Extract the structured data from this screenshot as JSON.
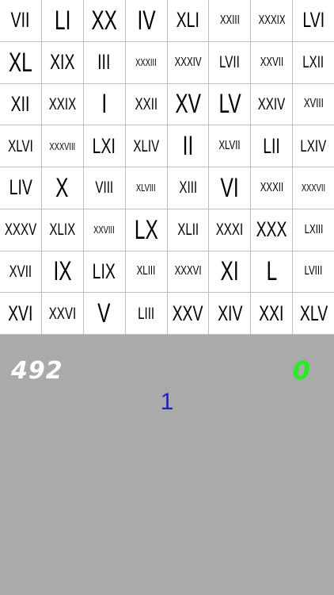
{
  "board": {
    "columns": 8,
    "rows": 8,
    "cells": [
      "VII",
      "LI",
      "XX",
      "IV",
      "XLI",
      "XXIII",
      "XXXIX",
      "LVI",
      "XL",
      "XIX",
      "III",
      "XXXIII",
      "XXXIV",
      "LVII",
      "XXVII",
      "LXII",
      "XII",
      "XXIX",
      "I",
      "XXII",
      "XV",
      "LV",
      "XXIV",
      "XVIII",
      "XLVI",
      "XXXVIII",
      "LXI",
      "XLIV",
      "II",
      "XLVII",
      "LII",
      "LXIV",
      "LIV",
      "X",
      "VIII",
      "XLVIII",
      "XIII",
      "VI",
      "XXXII",
      "XXXVII",
      "XXXV",
      "XLIX",
      "XXVIII",
      "LX",
      "XLII",
      "XXXI",
      "XXX",
      "LXIII",
      "XVII",
      "IX",
      "LIX",
      "XLIII",
      "XXXVI",
      "XI",
      "L",
      "LVIII",
      "XVI",
      "XXVI",
      "V",
      "LIII",
      "XXV",
      "XIV",
      "XXI",
      "XLV"
    ]
  },
  "status": {
    "timer": "492",
    "score": "0",
    "target": "1"
  },
  "colors": {
    "panel_background": "#aaaaaa",
    "grid_lines": "#bdbdbd",
    "timer_text": "#ffffff",
    "score_text": "#22ee22",
    "target_text": "#1e1ec8"
  }
}
